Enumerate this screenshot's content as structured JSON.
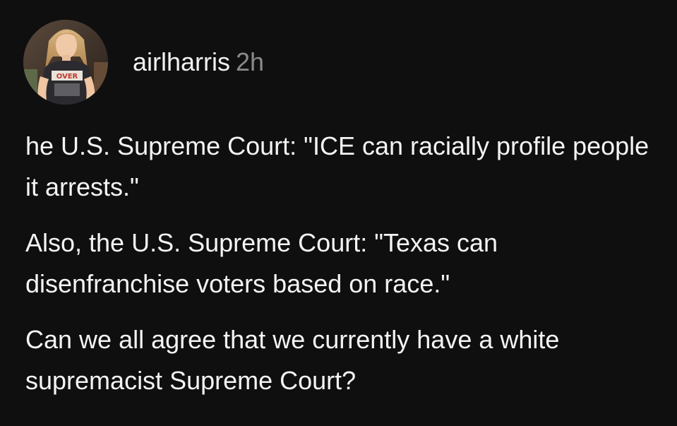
{
  "post": {
    "author": {
      "username": "airlharris",
      "time_ago": "2h",
      "avatar_shirt_text": "OVER"
    },
    "paragraphs": [
      "he U.S. Supreme Court: \"ICE can racially profile people it arrests.\"",
      "Also, the U.S. Supreme Court: \"Texas can disenfranchise voters based on race.\"",
      "Can we all agree that we currently have a white supremacist Supreme Court?"
    ]
  },
  "colors": {
    "background": "#0f0f10",
    "text": "#f4f4f4",
    "muted": "#8a8a8a"
  }
}
